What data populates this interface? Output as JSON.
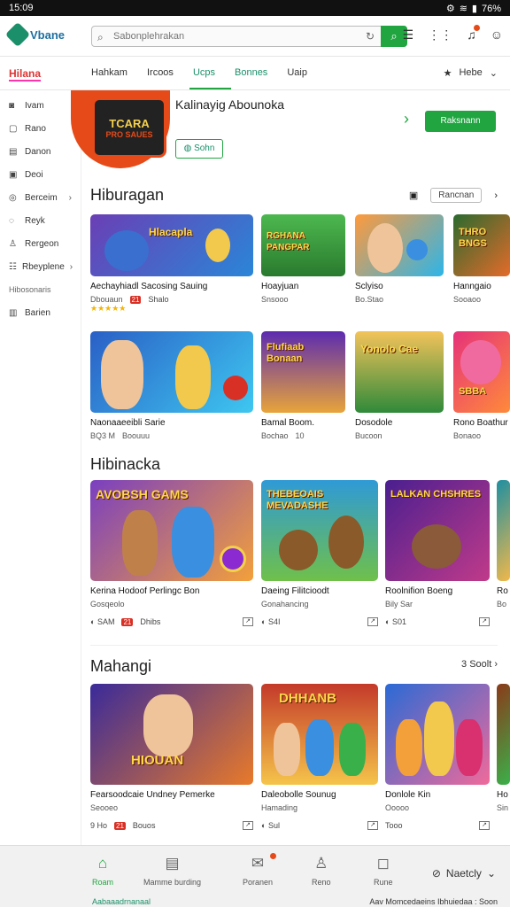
{
  "status": {
    "time": "15:09",
    "battery": "76%"
  },
  "header": {
    "logo_text": "Vbane",
    "search_placeholder": "Sabonplehrakan"
  },
  "nav": {
    "brand": "Hilana",
    "tabs": [
      "Hahkam",
      "Ircoos",
      "Ucps",
      "Bonnes",
      "Uaip"
    ],
    "right_label": "Hebe"
  },
  "sidebar": {
    "items": [
      {
        "label": "Ivam",
        "icon": "camera-icon"
      },
      {
        "label": "Rano",
        "icon": "bookmark-icon"
      },
      {
        "label": "Danon",
        "icon": "calendar-icon"
      },
      {
        "label": "Deoi",
        "icon": "gift-icon"
      },
      {
        "label": "Berceim",
        "icon": "coin-icon",
        "arrow": true
      },
      {
        "label": "Reyk",
        "icon": "chat-icon"
      },
      {
        "label": "Rergeon",
        "icon": "user-icon"
      },
      {
        "label": "Rbeyplene",
        "icon": "list-icon",
        "arrow": true
      },
      {
        "label": "Hibosonaris",
        "icon": "",
        "small": true
      },
      {
        "label": "Barien",
        "icon": "book-icon"
      }
    ]
  },
  "featured": {
    "art_top": "TCARA",
    "art_bottom": "PRO SAUES",
    "title": "Kalinayig Abounoka",
    "button": "Sohn",
    "cta": "Raksnann"
  },
  "section1": {
    "title": "Hiburagan",
    "filter": "Rancnan",
    "cards": [
      {
        "art": "Hlacapla",
        "title": "Aechayhiadl Sacosing Sauing",
        "sub": "Dbouaun",
        "stars": "★★★★★",
        "badge": "21",
        "meta": "Shalo",
        "c1": "#6a3fb5",
        "c2": "#2a86d8"
      },
      {
        "art": "RGHANA PANGPAR",
        "title": "Hoayjuan",
        "sub": "Snsooo",
        "c1": "#3aa33f",
        "c2": "#7ed957"
      },
      {
        "art": "",
        "title": "Sclyiso",
        "sub": "Bo.Stao",
        "c1": "#ff9a3c",
        "c2": "#2cb5e8"
      },
      {
        "art": "THRO BNGS",
        "title": "Hanngaio",
        "sub": "Sooaoo",
        "c1": "#2b6a2e",
        "c2": "#e46b2a"
      }
    ]
  },
  "section1b": {
    "cards": [
      {
        "art": "",
        "title": "Naonaaeeibli Sarie",
        "sub": "BQ3 M",
        "sub2": "Boouuu",
        "c1": "#2a5fc6",
        "c2": "#3ec7f0"
      },
      {
        "art": "Flufiaab Bonaan",
        "title": "Bamal Boom.",
        "sub": "Bochao",
        "meta2": "10",
        "c1": "#5c2bb0",
        "c2": "#e8a43a"
      },
      {
        "art": "Yonolo Cae",
        "title": "Dosodole",
        "sub": "Bucoon",
        "c1": "#2f8a3a",
        "c2": "#f3c35a"
      },
      {
        "art": "SBBA",
        "title": "Rono Boathur",
        "sub": "Bonaoo",
        "c1": "#e6327a",
        "c2": "#ff8a3a"
      }
    ]
  },
  "section2": {
    "title": "Hibinacka",
    "cards": [
      {
        "art": "AVOBSH GAMS",
        "title": "Kerina Hodoof Perlingc Bon",
        "sub": "Gosqeolo",
        "meta": "SAM",
        "badge": "21",
        "meta2": "Dhibs",
        "c1": "#7a3fc0",
        "c2": "#f3a03a"
      },
      {
        "art": "THEBEOAIS MEVADASHE",
        "title": "Daeing Filitcioodt",
        "sub": "Gonahancing",
        "meta": "S4I",
        "c1": "#2f9ad6",
        "c2": "#6fc04a"
      },
      {
        "art": "LALKAN CHSHRES",
        "title": "Roolnifion Boeng",
        "sub": "Bily Sar",
        "meta": "S01",
        "c1": "#4a1f8f",
        "c2": "#c03a8a"
      },
      {
        "art": "",
        "title": "Ro",
        "sub": "Bo",
        "c1": "#1e8fa0",
        "c2": "#f0b84a"
      }
    ]
  },
  "section3": {
    "title": "Mahangi",
    "more": "3 Soolt",
    "cards": [
      {
        "art": "HIOUAN",
        "title": "Fearsoodcaie Undney Pemerke",
        "sub": "Seooeo",
        "meta": "9 Ho",
        "badge": "21",
        "meta2": "Bouos",
        "c1": "#3a2a9a",
        "c2": "#e87a2a"
      },
      {
        "art": "DHHANB",
        "title": "Daleobolle Sounug",
        "sub": "Hamading",
        "meta": "Sul",
        "c1": "#c43a2a",
        "c2": "#f5c44a"
      },
      {
        "art": "",
        "title": "Donlole Kin",
        "sub": "Ooooo",
        "meta": "Tooo",
        "c1": "#2a6ad6",
        "c2": "#f06a9a"
      },
      {
        "art": "",
        "title": "Ho",
        "sub": "Sin",
        "c1": "#8a3a1a",
        "c2": "#3ab04a"
      }
    ]
  },
  "bottomnav": {
    "items": [
      "Roam",
      "Mamme burding",
      "Poranen",
      "Reno",
      "Rune"
    ],
    "right_label": "Naetcly",
    "footer_left": "Aabaaadrnanaal",
    "footer_right": "Aav Momcedaeins Ibhuiedaa : Soon"
  }
}
